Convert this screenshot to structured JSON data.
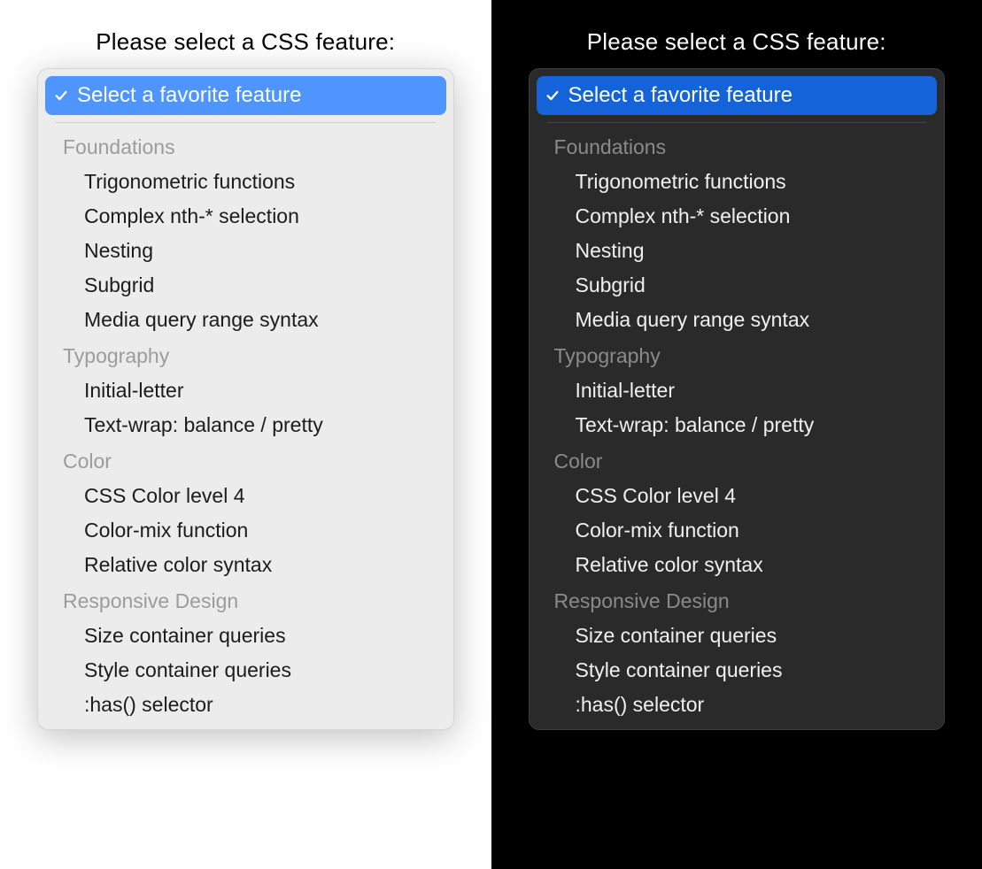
{
  "prompt": "Please select a CSS feature:",
  "selected": {
    "label": "Select a favorite feature"
  },
  "colors": {
    "light_accent": "#4f95ff",
    "dark_accent": "#1463d8",
    "light_bg": "#ececec",
    "dark_bg": "#2a2a2a"
  },
  "groups": [
    {
      "label": "Foundations",
      "options": [
        "Trigonometric functions",
        "Complex nth-* selection",
        "Nesting",
        "Subgrid",
        "Media query range syntax"
      ]
    },
    {
      "label": "Typography",
      "options": [
        "Initial-letter",
        "Text-wrap: balance / pretty"
      ]
    },
    {
      "label": "Color",
      "options": [
        "CSS Color level 4",
        "Color-mix function",
        "Relative color syntax"
      ]
    },
    {
      "label": "Responsive Design",
      "options": [
        "Size container queries",
        "Style container queries",
        ":has() selector"
      ]
    }
  ]
}
